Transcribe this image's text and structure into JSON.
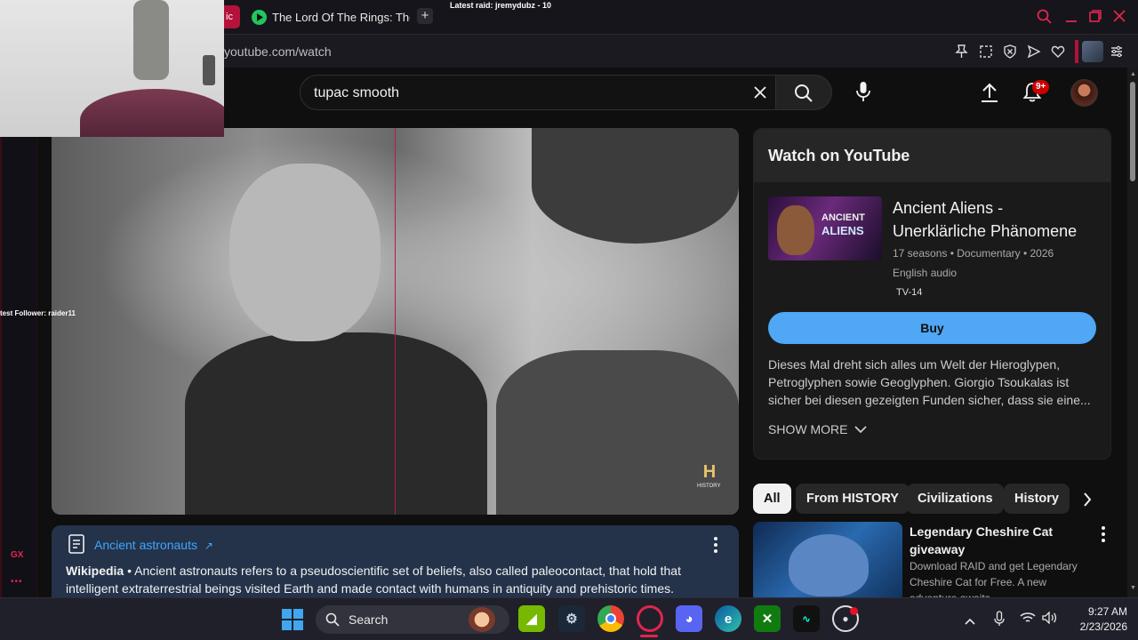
{
  "browser": {
    "tab_title": "The Lord Of The Rings: The",
    "tab_left_fragment": "ic",
    "url": "youtube.com/watch",
    "overlay_raid": "Latest raid: jremydubz - 10",
    "overlay_follower": "test Follower: raider11",
    "sidebar_gx": "GX",
    "sidebar_more": "•••"
  },
  "header": {
    "search_value": "tupac smooth",
    "notif_badge": "9+"
  },
  "video": {
    "watermark": "HISTORY"
  },
  "info_card": {
    "topic_link": "Ancient astronauts",
    "source": "Wikipedia",
    "text": "• Ancient astronauts refers to a pseudoscientific set of beliefs, also called paleocontact, that hold that intelligent extraterrestrial beings visited Earth and made contact with humans in antiquity and prehistoric times."
  },
  "watch_panel": {
    "heading": "Watch on YouTube",
    "show_title": "Ancient Aliens - Unerklärliche Phänomene",
    "thumb_text_1": "ANCIENT",
    "thumb_text_2": "ALIENS",
    "meta": "17 seasons • Documentary • 2026",
    "audio": "English audio",
    "rating": "TV-14",
    "buy_label": "Buy",
    "description": "Dieses Mal dreht sich alles um Welt der Hieroglypen, Petroglyphen sowie Geoglyphen. Giorgio Tsoukalas ist sicher bei diesen gezeigten Funden sicher, dass sie eine...",
    "show_more": "SHOW MORE"
  },
  "chips": [
    "All",
    "From HISTORY",
    "Civilizations",
    "History"
  ],
  "rec": {
    "title": "Legendary Cheshire Cat giveaway",
    "desc": "Download RAID and get Legendary Cheshire Cat for Free. A new adventure awaits"
  },
  "taskbar": {
    "search_label": "Search",
    "time": "9:27 AM",
    "date": "2/23/2026"
  },
  "colors": {
    "accent_red": "#e0264f",
    "buy_blue": "#4fa7f5",
    "link_blue": "#3ea6ff",
    "info_bg": "#24334a"
  }
}
